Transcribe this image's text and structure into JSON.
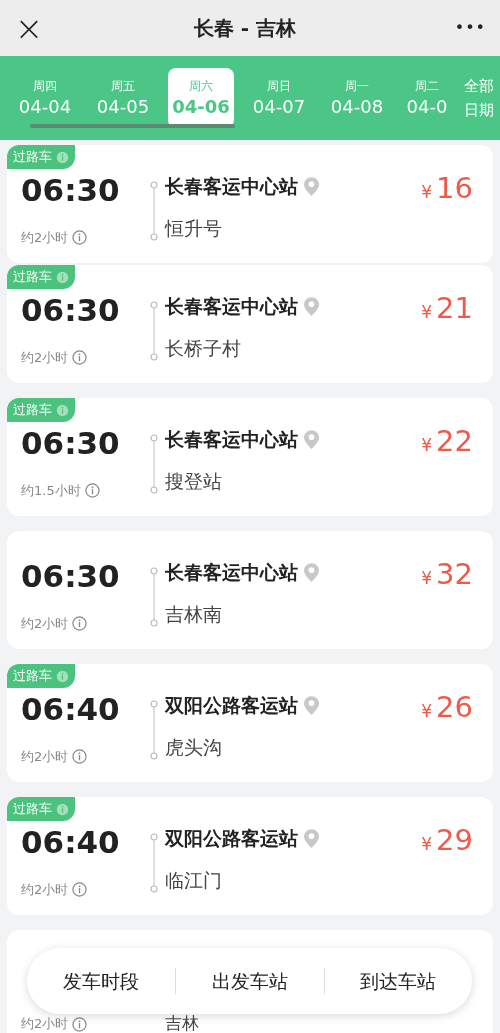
{
  "header": {
    "close": "×",
    "title": "长春 - 吉林",
    "more": "•••"
  },
  "date_tabs": [
    {
      "weekday": "周四",
      "date": "04-04",
      "selected": false
    },
    {
      "weekday": "周五",
      "date": "04-05",
      "selected": false
    },
    {
      "weekday": "周六",
      "date": "04-06",
      "selected": true
    },
    {
      "weekday": "周日",
      "date": "04-07",
      "selected": false
    },
    {
      "weekday": "周一",
      "date": "04-08",
      "selected": false
    },
    {
      "weekday": "周二",
      "date": "04-0",
      "selected": false
    }
  ],
  "all_dates": {
    "line1": "全部",
    "line2": "日期"
  },
  "trips": [
    {
      "tag": "过路车",
      "time": "06:30",
      "duration": "约2小时",
      "from": "长春客运中心站",
      "to": "恒升号",
      "currency": "¥",
      "price": "16"
    },
    {
      "tag": "过路车",
      "time": "06:30",
      "duration": "约2小时",
      "from": "长春客运中心站",
      "to": "长桥子村",
      "currency": "¥",
      "price": "21"
    },
    {
      "tag": "过路车",
      "time": "06:30",
      "duration": "约1.5小时",
      "from": "长春客运中心站",
      "to": "搜登站",
      "currency": "¥",
      "price": "22"
    },
    {
      "time": "06:30",
      "duration": "约2小时",
      "from": "长春客运中心站",
      "to": "吉林南",
      "currency": "¥",
      "price": "32"
    },
    {
      "tag": "过路车",
      "time": "06:40",
      "duration": "约2小时",
      "from": "双阳公路客运站",
      "to": "虎头沟",
      "currency": "¥",
      "price": "26"
    },
    {
      "tag": "过路车",
      "time": "06:40",
      "duration": "约2小时",
      "from": "双阳公路客运站",
      "to": "临江门",
      "currency": "¥",
      "price": "29"
    }
  ],
  "partial_trip": {
    "duration": "约2小时",
    "to": "吉林"
  },
  "filter_bar": [
    "发车时段",
    "出发车站",
    "到达车站"
  ]
}
